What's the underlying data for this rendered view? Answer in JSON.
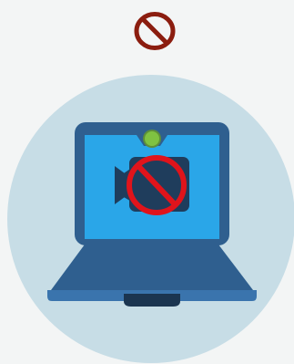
{
  "illustration": {
    "subject": "laptop-camera-disabled",
    "icons": [
      "prohibited-icon",
      "laptop-icon",
      "video-camera-icon",
      "webcam-indicator-icon"
    ],
    "colors": {
      "background": "#f3f5f5",
      "circle": "#c7dde6",
      "prohibited_top": "#8b1d0f",
      "prohibited_overlay": "#e0141b",
      "laptop_frame": "#2f5f8f",
      "screen": "#2aa6e8",
      "camera_body": "#1f3d5c",
      "webcam_light": "#7fc241",
      "base_top": "#3a74ad",
      "base_front": "#2c5d8c",
      "hinge": "#1b3550"
    }
  }
}
